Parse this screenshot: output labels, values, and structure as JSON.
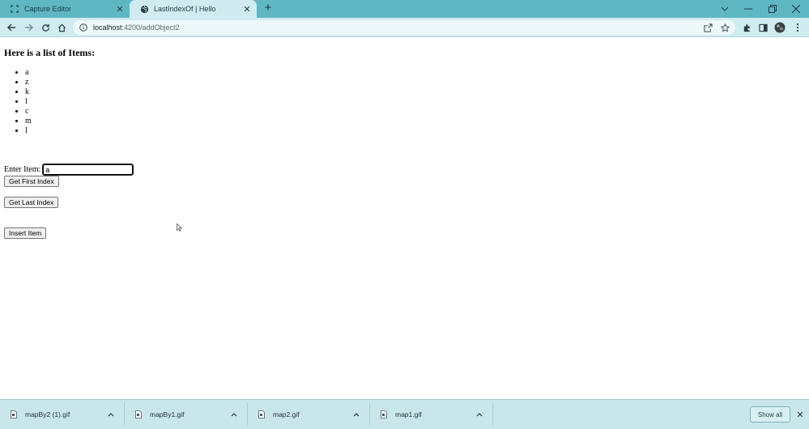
{
  "tabs": [
    {
      "label": "Capture Editor",
      "icon": "capture-icon",
      "active": false
    },
    {
      "label": "LastIndexOf | Hello",
      "icon": "globe-icon",
      "active": true
    }
  ],
  "window_controls": [
    "chevron-down-icon",
    "minimize-icon",
    "restore-icon",
    "close-icon"
  ],
  "address_bar": {
    "host": "localhost",
    "path": ":4200/addObject2"
  },
  "page": {
    "heading": "Here is a list of Items:",
    "items": [
      "a",
      "z",
      "k",
      "l",
      "c",
      "m",
      "l"
    ],
    "enter_label": "Enter Item:",
    "input_value": "a",
    "btn_first": "Get First Index",
    "btn_last": "Get Last Index",
    "btn_insert": "Insert Item"
  },
  "downloads": {
    "files": [
      {
        "name": "mapBy2 (1).gif"
      },
      {
        "name": "mapBy1.gif"
      },
      {
        "name": "map2.gif"
      },
      {
        "name": "map1.gif"
      }
    ],
    "show_all": "Show all"
  },
  "colors": {
    "tab_strip": "#5fb7c4",
    "toolbar": "#d0ecf0",
    "shelf": "#c9e7eb"
  }
}
